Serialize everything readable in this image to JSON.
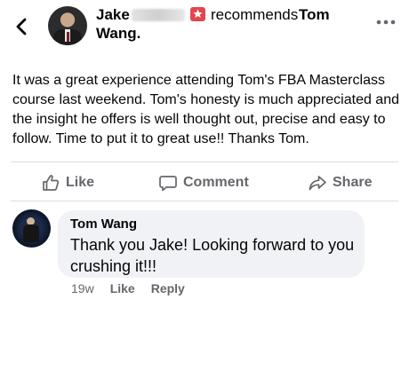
{
  "post": {
    "author_first": "Jake",
    "recommends_label": "recommends",
    "target_first": "Tom",
    "target_last": "Wang.",
    "body": "It was a great experience attending Tom's FBA Masterclass course last weekend. Tom's honesty is much appreciated and the insight he offers is well thought out, precise and easy to follow. Time to put it to great use!! Thanks Tom."
  },
  "actions": {
    "like": "Like",
    "comment": "Comment",
    "share": "Share"
  },
  "comment": {
    "author": "Tom Wang",
    "text": "Thank you Jake! Looking forward to you crushing it!!!",
    "time": "19w",
    "like": "Like",
    "reply": "Reply"
  },
  "colors": {
    "recommend_icon": "#e4464f",
    "secondary_text": "#65676b",
    "bubble_bg": "#f0f2f5"
  }
}
